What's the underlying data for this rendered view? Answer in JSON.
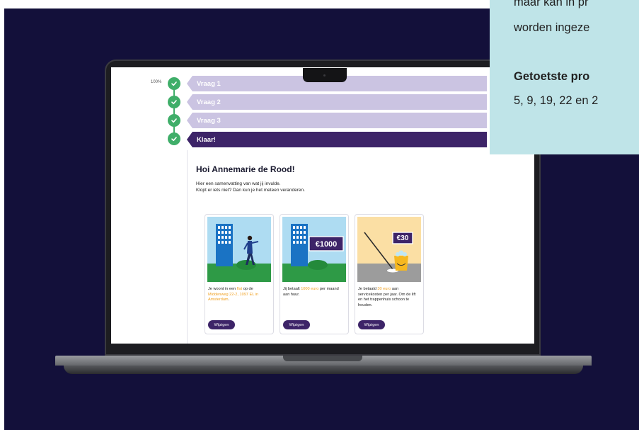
{
  "progress": {
    "label": "100%",
    "value": 1.0
  },
  "steps": [
    {
      "label": "Vraag 1",
      "status": "done"
    },
    {
      "label": "Vraag 2",
      "status": "done"
    },
    {
      "label": "Vraag 3",
      "status": "done"
    },
    {
      "label": "Klaar!",
      "status": "current"
    }
  ],
  "summary": {
    "greeting": "Hoi Annemarie de Rood!",
    "intro_line1": "Hier een samenvatting van wat jij invulde.",
    "intro_line2": "Klopt er iets niet? Dan kun je het meteen veranderen."
  },
  "cards": [
    {
      "illustration": "flat-walking-person-icon",
      "t1": "Je woont in een ",
      "h1": "flat",
      "t2": " op de ",
      "h2": "Middenweg 22-2, 1097 EL in Amsterdam",
      "t3": ".",
      "button": "Wijzigen"
    },
    {
      "illustration": "flat-rent-price-icon",
      "badge": "€1000",
      "t1": "Jij betaalt ",
      "h1": "1000 euro",
      "t2": " per maand aan huur.",
      "button": "Wijzigen"
    },
    {
      "illustration": "mop-bucket-icon",
      "badge": "€30",
      "t1": "Je betaald ",
      "h1": "30 euro",
      "t2": " aan servicekosten per jaar. Om de lift en het trappenhuis schoon te houden.",
      "button": "Wijzigen"
    }
  ],
  "overlay": {
    "line1": "maar kan in pr",
    "line2": "worden ingeze",
    "heading": "Getoetste pro",
    "line3": "5, 9, 19, 22 en 2"
  },
  "colors": {
    "background": "#13103a",
    "accent_purple": "#3d2468",
    "step_light": "#cbc4e2",
    "check_green": "#3fae69",
    "highlight_orange": "#f0a224",
    "overlay_bg": "#bfe4e8"
  }
}
